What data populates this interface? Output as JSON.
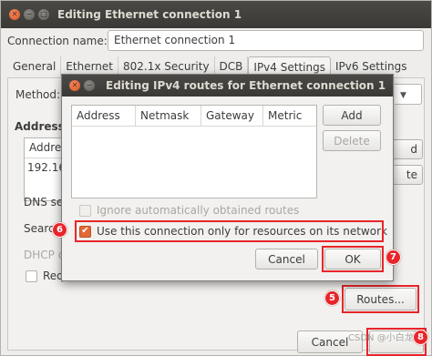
{
  "main_window": {
    "title": "Editing Ethernet connection 1",
    "connection_name_label": "Connection name:",
    "connection_name_value": "Ethernet connection 1",
    "tabs": [
      {
        "label": "General"
      },
      {
        "label": "Ethernet"
      },
      {
        "label": "802.1x Security"
      },
      {
        "label": "DCB"
      },
      {
        "label": "IPv4 Settings"
      },
      {
        "label": "IPv6 Settings"
      }
    ],
    "active_tab": "IPv4 Settings",
    "method_label": "Method:",
    "addresses_label": "Addresse",
    "address_col_label": "Addres",
    "address_value": "192.168",
    "add_button_tail": "d",
    "delete_button_tail": "te",
    "dns_label": "DNS ser",
    "search_label": "Searc",
    "dhcp_label": "DHCP c",
    "require_label": "Requ",
    "routes_button": "Routes...",
    "cancel_button": "Cancel"
  },
  "dialog": {
    "title": "Editing IPv4 routes for Ethernet connection 1",
    "columns": [
      "Address",
      "Netmask",
      "Gateway",
      "Metric"
    ],
    "add_button": "Add",
    "delete_button": "Delete",
    "ignore_routes_label": "Ignore automatically obtained routes",
    "only_resources_label": "Use this connection only for resources on its network",
    "cancel_button": "Cancel",
    "ok_button": "OK"
  },
  "annotations": {
    "step5": "5",
    "step6": "6",
    "step7": "7",
    "step8": "8"
  },
  "watermark": "CSDN @小白龙",
  "colors": {
    "accent_orange": "#e06b36",
    "annotation_red": "#e8252a",
    "titlebar": "#3a3936"
  }
}
